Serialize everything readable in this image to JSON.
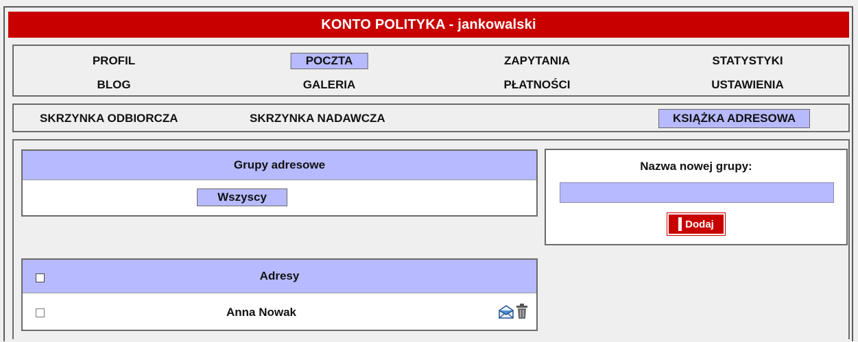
{
  "header": {
    "title": "KONTO POLITYKA - jankowalski"
  },
  "main_nav": {
    "row1": [
      "PROFIL",
      "POCZTA",
      "ZAPYTANIA",
      "STATYSTYKI"
    ],
    "row2": [
      "BLOG",
      "GALERIA",
      "PŁATNOŚCI",
      "USTAWIENIA"
    ],
    "active": "POCZTA"
  },
  "mail_nav": {
    "items": [
      "SKRZYNKA ODBIORCZA",
      "SKRZYNKA NADAWCZA",
      "KSIĄŻKA ADRESOWA"
    ],
    "active": "KSIĄŻKA ADRESOWA"
  },
  "groups": {
    "title": "Grupy adresowe",
    "items": [
      "Wszyscy"
    ]
  },
  "new_group": {
    "label": "Nazwa nowej grupy:",
    "value": "",
    "add_label": "Dodaj"
  },
  "addresses": {
    "title": "Adresy",
    "rows": [
      {
        "name": "Anna Nowak"
      }
    ]
  },
  "colors": {
    "brand_red": "#c80000",
    "highlight": "#b7baff",
    "panel_bg": "#efefef"
  },
  "icons": [
    "envelope-icon",
    "trash-icon"
  ]
}
